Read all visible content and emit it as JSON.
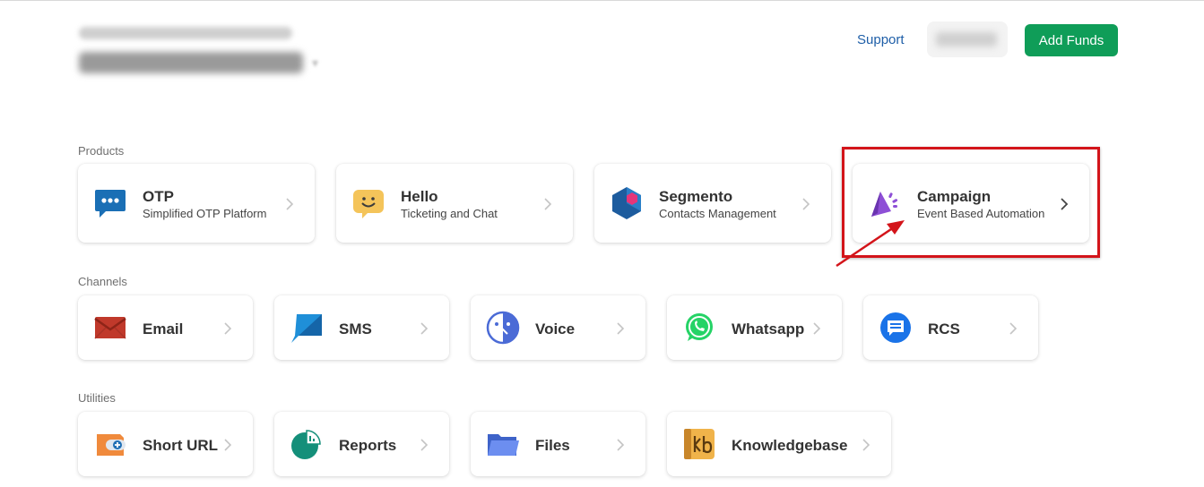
{
  "header": {
    "support_label": "Support",
    "add_funds_label": "Add Funds"
  },
  "sections": {
    "products_label": "Products",
    "channels_label": "Channels",
    "utilities_label": "Utilities"
  },
  "products": [
    {
      "title": "OTP",
      "subtitle": "Simplified OTP Platform",
      "icon": "chat-dots-icon"
    },
    {
      "title": "Hello",
      "subtitle": "Ticketing and Chat",
      "icon": "smiley-chat-icon"
    },
    {
      "title": "Segmento",
      "subtitle": "Contacts Management",
      "icon": "hexagon-icon"
    },
    {
      "title": "Campaign",
      "subtitle": "Event Based Automation",
      "icon": "megaphone-icon"
    }
  ],
  "channels": [
    {
      "title": "Email",
      "icon": "envelope-icon"
    },
    {
      "title": "SMS",
      "icon": "sms-bubble-icon"
    },
    {
      "title": "Voice",
      "icon": "voice-face-icon"
    },
    {
      "title": "Whatsapp",
      "icon": "whatsapp-icon"
    },
    {
      "title": "RCS",
      "icon": "rcs-chat-icon"
    }
  ],
  "utilities": [
    {
      "title": "Short URL",
      "icon": "link-tag-icon"
    },
    {
      "title": "Reports",
      "icon": "pie-chart-icon"
    },
    {
      "title": "Files",
      "icon": "folder-icon"
    },
    {
      "title": "Knowledgebase",
      "icon": "kb-book-icon"
    }
  ],
  "colors": {
    "accent_green": "#0f9d58",
    "link_blue": "#1f5fa8",
    "annotation_red": "#d3141a"
  }
}
